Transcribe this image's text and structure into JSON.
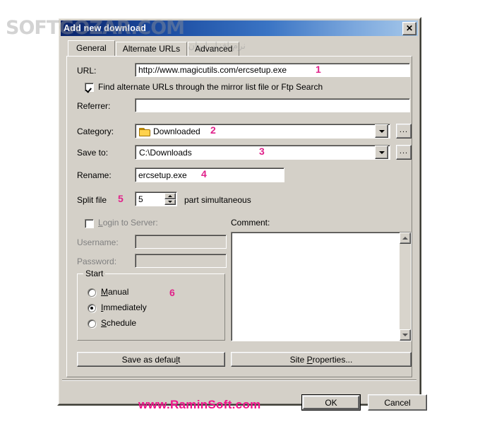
{
  "watermark": {
    "main_text": "SOFTGOZAR.COM",
    "sub_text": "نرم افزار ایران"
  },
  "dialog": {
    "title": "Add new download",
    "close_label": "✕"
  },
  "tabs": [
    {
      "label": "General",
      "selected": true
    },
    {
      "label": "Alternate URLs",
      "selected": false
    },
    {
      "label": "Advanced",
      "selected": false
    }
  ],
  "form": {
    "url_label": "URL:",
    "url_value": "http://www.magicutils.com/ercsetup.exe",
    "find_alternate_label": "Find alternate URLs through the mirror list file or Ftp Search",
    "find_alternate_checked": true,
    "referrer_label": "Referrer:",
    "referrer_value": "",
    "category_label": "Category:",
    "category_value": "Downloaded",
    "category_icon": "folder-icon",
    "save_to_label": "Save to:",
    "save_to_value": "C:\\Downloads",
    "rename_label": "Rename:",
    "rename_value": "ercsetup.exe",
    "split_file_label": "Split file",
    "split_file_value": "5",
    "split_file_suffix": "part simultaneous",
    "browse_button_label": "...",
    "login_label": "Login to Server:",
    "login_checked": false,
    "username_label": "Username:",
    "username_value": "",
    "password_label": "Password:",
    "password_value": "",
    "comment_label": "Comment:",
    "comment_value": ""
  },
  "start_group": {
    "title": "Start",
    "options": [
      {
        "label": "Manual",
        "accel": "M",
        "selected": false
      },
      {
        "label": "Immediately",
        "accel": "I",
        "selected": true
      },
      {
        "label": "Schedule",
        "accel": "S",
        "selected": false
      }
    ]
  },
  "buttons": {
    "save_as_default": "Save as default",
    "site_properties": "Site Properties...",
    "ok": "OK",
    "cancel": "Cancel"
  },
  "branding": {
    "site": "www.RaminSoft.com",
    "color": "#f0158c"
  },
  "annotations": [
    {
      "number": "1",
      "target": "url-field"
    },
    {
      "number": "2",
      "target": "category-combo"
    },
    {
      "number": "3",
      "target": "save-to-combo"
    },
    {
      "number": "4",
      "target": "rename-field"
    },
    {
      "number": "5",
      "target": "split-file-label"
    },
    {
      "number": "6",
      "target": "start-group"
    }
  ]
}
